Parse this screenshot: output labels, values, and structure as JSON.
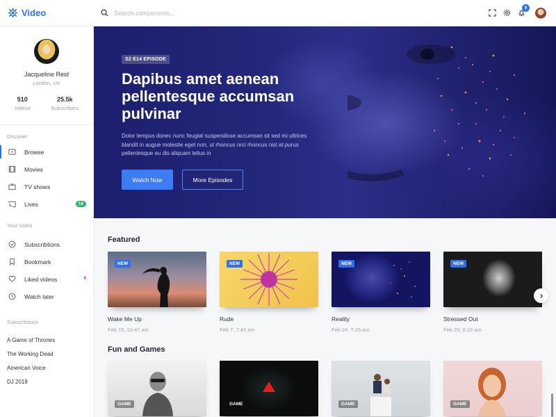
{
  "app": {
    "name": "Video"
  },
  "search": {
    "placeholder": "Search components..."
  },
  "header": {
    "notification_count": "9"
  },
  "profile": {
    "name": "Jacqueline Reid",
    "location": "London, UK",
    "stats": [
      {
        "value": "510",
        "label": "Videos"
      },
      {
        "value": "25.5k",
        "label": "Subscribers"
      }
    ]
  },
  "sidebar": {
    "discover_title": "Discover",
    "discover": [
      {
        "label": "Browse",
        "icon": "play-box-icon"
      },
      {
        "label": "Movies",
        "icon": "film-icon"
      },
      {
        "label": "TV shows",
        "icon": "tv-icon"
      },
      {
        "label": "Lives",
        "icon": "cast-icon",
        "badge": "16"
      }
    ],
    "your_video_title": "Your Video",
    "your_video": [
      {
        "label": "Subscribtions",
        "icon": "check-circle-icon"
      },
      {
        "label": "Bookmark",
        "icon": "bookmark-icon"
      },
      {
        "label": "Liked videos",
        "icon": "heart-icon",
        "badge": "9"
      },
      {
        "label": "Watch later",
        "icon": "clock-icon"
      }
    ],
    "subscriptions_title": "Subscribtions",
    "subscriptions": [
      "A Game of Thrones",
      "The Working Dead",
      "American Voice",
      "DJ 2018"
    ]
  },
  "hero": {
    "tag": "S2 E14 EPISODE",
    "title": "Dapibus amet aenean pellentesque accumsan pulvinar",
    "description": "Dolor tempus donec nunc feugiat suspendisse accumsan sit sed mi ultrices blandit in augue molestie eget non, ut rhoncus orci rhoncus nisl at purus pellentesque eu dis aliquam tellus in",
    "watch_label": "Watch Now",
    "more_label": "More Episodes"
  },
  "featured": {
    "title": "Featured",
    "badge": "NEW",
    "items": [
      {
        "title": "Wake Me Up",
        "date": "Feb 15, 10:47 am"
      },
      {
        "title": "Rude",
        "date": "Feb 7, 7:43 am"
      },
      {
        "title": "Reality",
        "date": "Feb 24, 7:26 am"
      },
      {
        "title": "Stressed Out",
        "date": "Feb 23, 8:18 am"
      }
    ]
  },
  "fun": {
    "title": "Fun and Games",
    "badge": "GAME"
  },
  "colors": {
    "accent": "#2f6ff0",
    "hero_bg": "#1c1f6e",
    "live_badge": "#2fb66b",
    "liked_badge": "#e5334f"
  }
}
